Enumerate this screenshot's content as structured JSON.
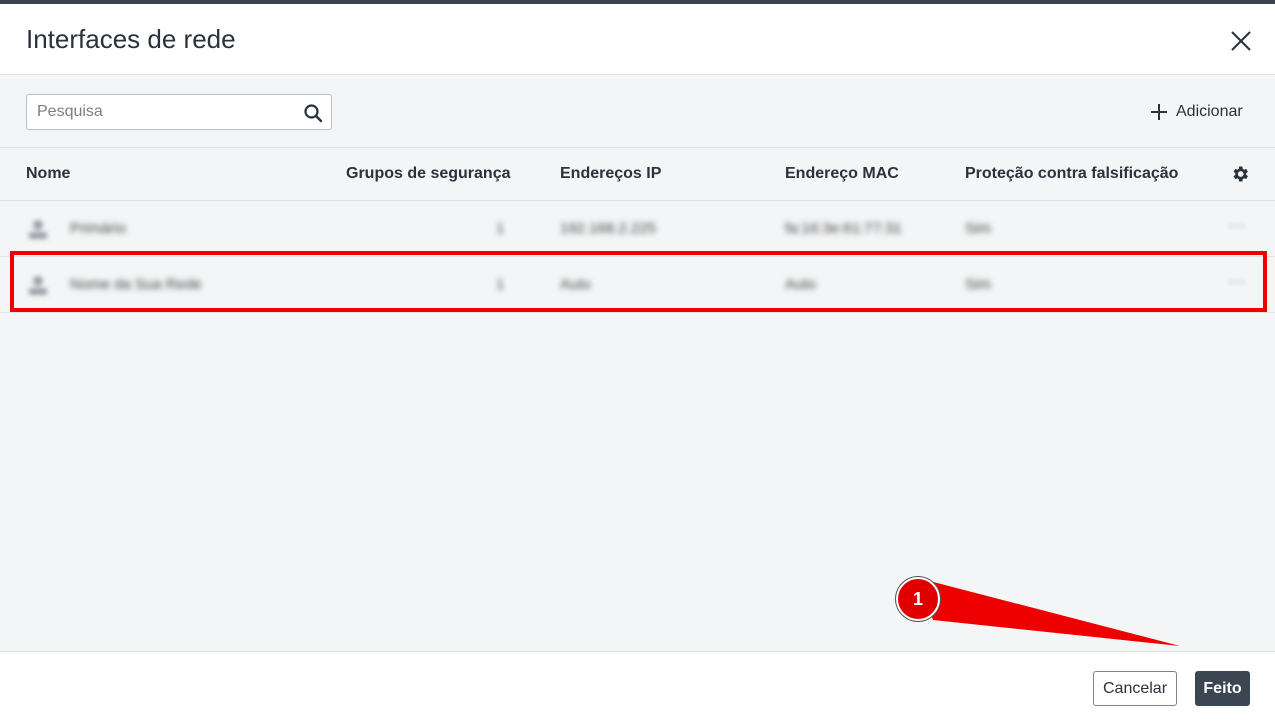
{
  "dialog": {
    "title": "Interfaces de rede",
    "close_icon": "close-icon"
  },
  "toolbar": {
    "search_placeholder": "Pesquisa",
    "search_icon": "search-icon",
    "add_label": "Adicionar",
    "add_icon": "plus-icon"
  },
  "table": {
    "columns": [
      "Nome",
      "Grupos de segurança",
      "Endereços IP",
      "Endereço MAC",
      "Proteção contra falsificação"
    ],
    "settings_icon": "gear-icon",
    "rows": [
      {
        "name": "Primário",
        "groups": "1",
        "ip": "192.168.2.225",
        "mac": "fa:16:3e:61:77:31",
        "spoof": "Sim",
        "more": "···"
      },
      {
        "name": "Nome da Sua Rede",
        "groups": "1",
        "ip": "Auto",
        "mac": "Auto",
        "spoof": "Sim",
        "more": "···"
      }
    ]
  },
  "footer": {
    "cancel_label": "Cancelar",
    "done_label": "Feito"
  },
  "annotation": {
    "step_number": "1",
    "highlight_color": "#ee0000"
  },
  "colors": {
    "primary_button": "#3c4552",
    "top_bar": "#3a414d",
    "body_bg": "#f4f5f6"
  }
}
